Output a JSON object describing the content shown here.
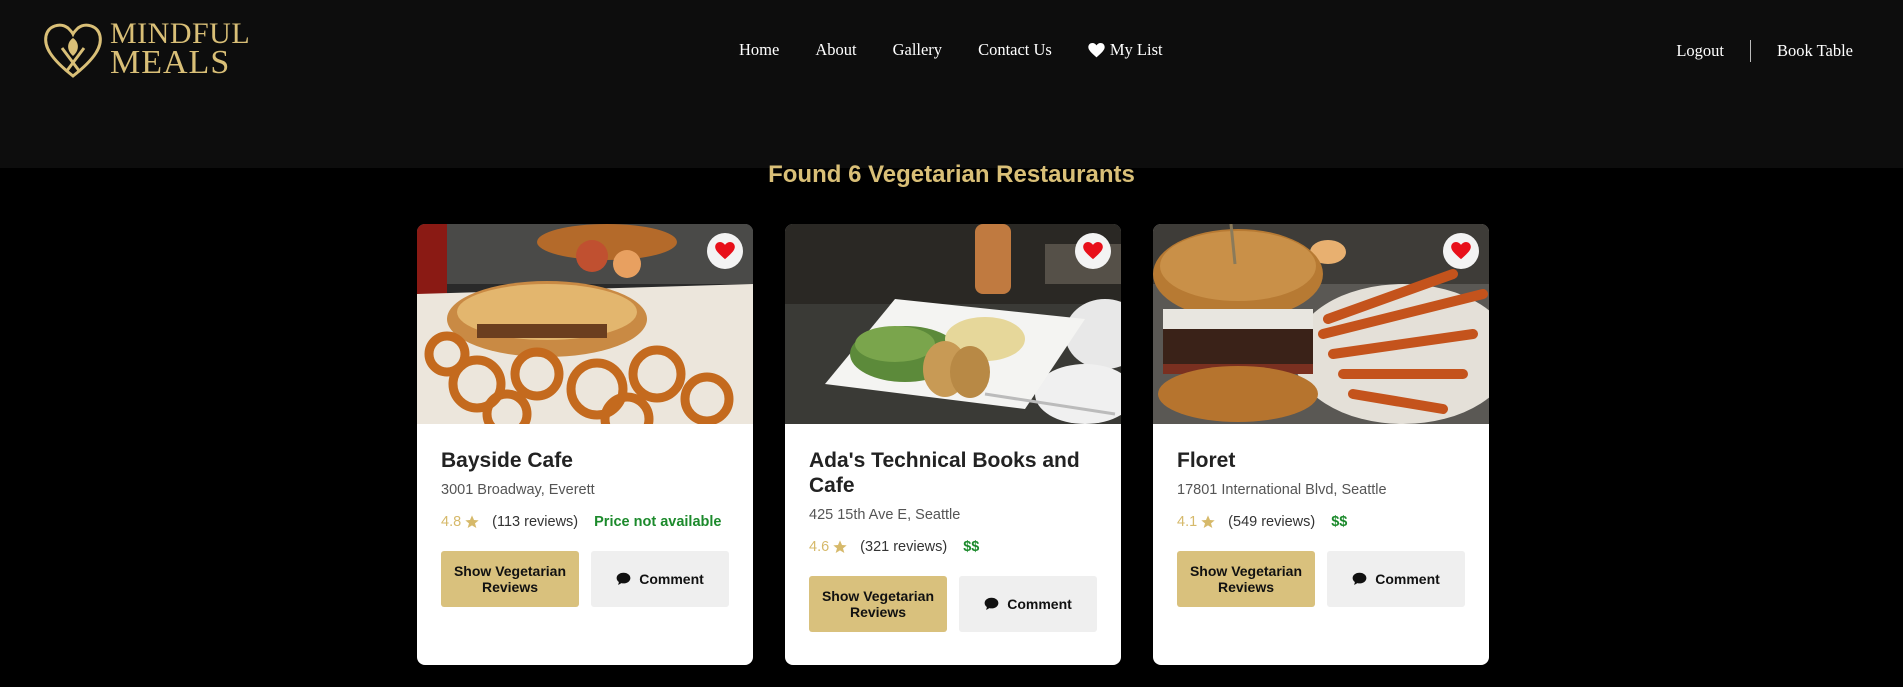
{
  "header": {
    "logo": {
      "line1": "MINDFUL",
      "line2": "MEALS"
    },
    "nav": [
      {
        "label": "Home"
      },
      {
        "label": "About"
      },
      {
        "label": "Gallery"
      },
      {
        "label": "Contact Us"
      },
      {
        "label": "My List",
        "icon": "heart-icon"
      }
    ],
    "right_nav": {
      "logout": "Logout",
      "book": "Book Table"
    }
  },
  "results": {
    "heading": "Found 6 Vegetarian Restaurants"
  },
  "colors": {
    "accent": "#d9bf77",
    "price_green": "#1c8a2c",
    "heart_red": "#e8101a"
  },
  "restaurants": [
    {
      "name": "Bayside Cafe",
      "address": "3001 Broadway, Everett",
      "rating": "4.8",
      "reviews": "(113 reviews)",
      "price": "Price not available",
      "veg_button": "Show Vegetarian Reviews",
      "comment_button": "Comment"
    },
    {
      "name": "Ada's Technical Books and Cafe",
      "address": "425 15th Ave E, Seattle",
      "rating": "4.6",
      "reviews": "(321 reviews)",
      "price": "$$",
      "veg_button": "Show Vegetarian Reviews",
      "comment_button": "Comment"
    },
    {
      "name": "Floret",
      "address": "17801 International Blvd, Seattle",
      "rating": "4.1",
      "reviews": "(549 reviews)",
      "price": "$$",
      "veg_button": "Show Vegetarian Reviews",
      "comment_button": "Comment"
    }
  ]
}
